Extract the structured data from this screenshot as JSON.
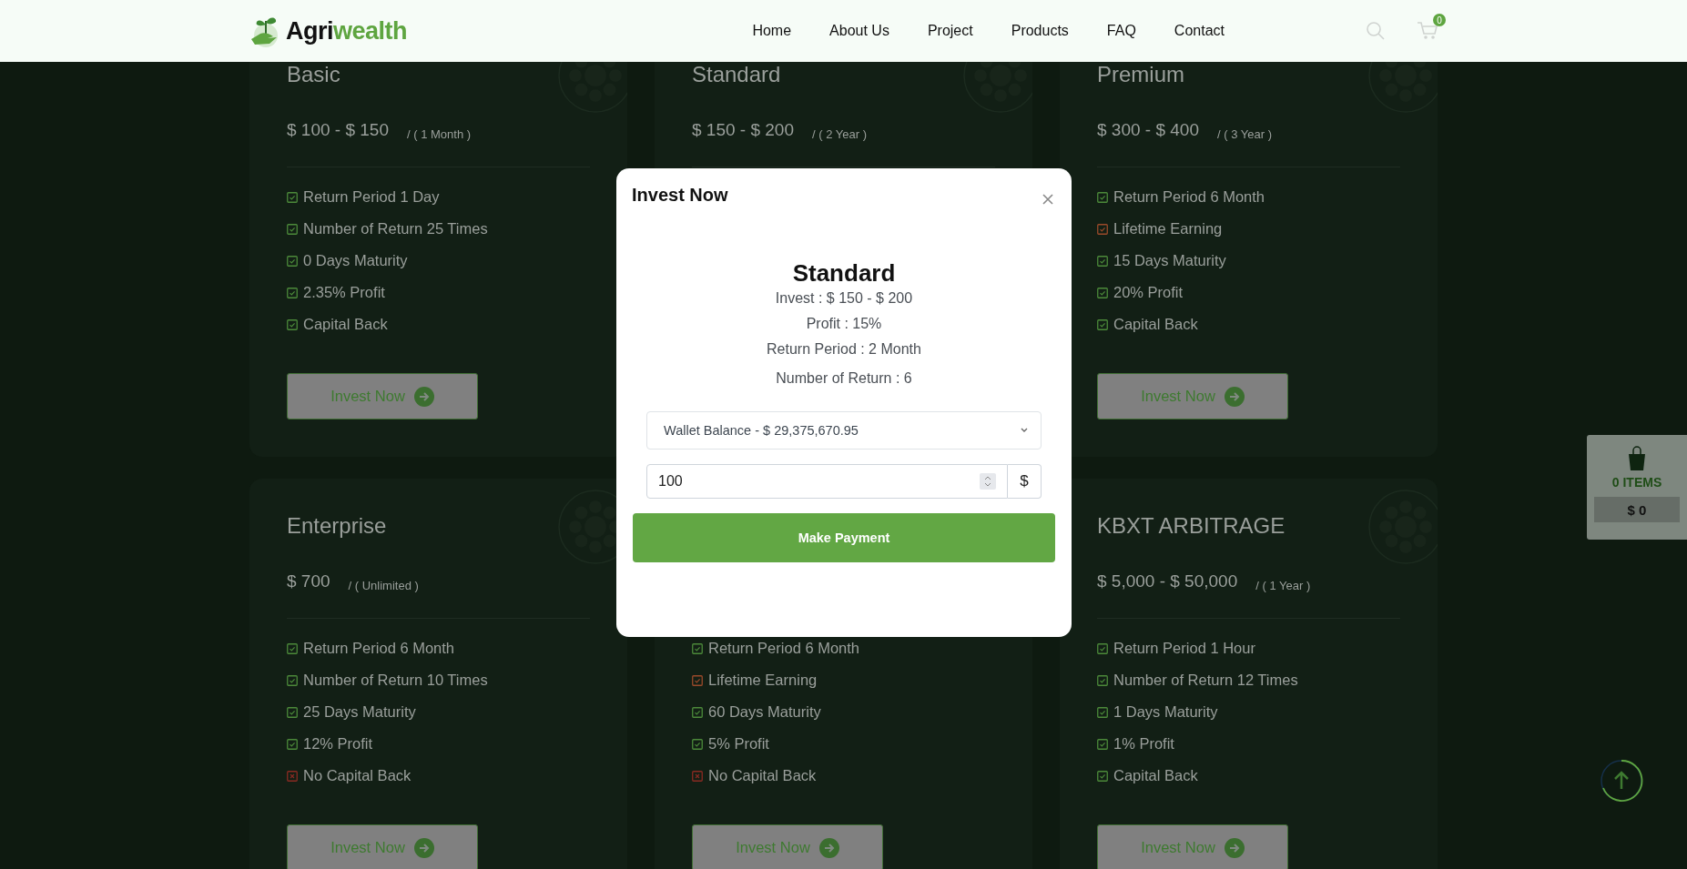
{
  "header": {
    "logo": {
      "text_1": "Agri",
      "text_2": "wealth"
    },
    "nav": [
      {
        "label": "Home"
      },
      {
        "label": "About Us"
      },
      {
        "label": "Project"
      },
      {
        "label": "Products"
      },
      {
        "label": "FAQ"
      },
      {
        "label": "Contact"
      }
    ],
    "cart_count": "0"
  },
  "plans": [
    {
      "title": "Basic",
      "price": "$ 100 - $ 150",
      "period": "/ ( 1 Month )",
      "features": [
        {
          "text": "Return Period 1 Day",
          "kind": "included"
        },
        {
          "text": "Number of Return 25 Times",
          "kind": "included"
        },
        {
          "text": "0 Days Maturity",
          "kind": "included"
        },
        {
          "text": "2.35% Profit",
          "kind": "included"
        },
        {
          "text": "Capital Back",
          "kind": "included"
        }
      ],
      "button": "Invest Now"
    },
    {
      "title": "Standard",
      "price": "$ 150 - $ 200",
      "period": "/ ( 2 Year )"
    },
    {
      "title": "Premium",
      "price": "$ 300 - $ 400",
      "period": "/ ( 3 Year )",
      "features": [
        {
          "text": "Return Period 6 Month",
          "kind": "included"
        },
        {
          "text": "Lifetime Earning",
          "kind": "bonus"
        },
        {
          "text": "15 Days Maturity",
          "kind": "included"
        },
        {
          "text": "20% Profit",
          "kind": "included"
        },
        {
          "text": "Capital Back",
          "kind": "included"
        }
      ],
      "button": "Invest Now"
    },
    {
      "title": "Enterprise",
      "price": "$ 700",
      "period": "/ ( Unlimited )",
      "features": [
        {
          "text": "Return Period 6 Month",
          "kind": "included"
        },
        {
          "text": "Number of Return 10 Times",
          "kind": "included"
        },
        {
          "text": "25 Days Maturity",
          "kind": "included"
        },
        {
          "text": "12% Profit",
          "kind": "included"
        },
        {
          "text": "No Capital Back",
          "kind": "excluded"
        }
      ],
      "button": "Invest Now"
    },
    {
      "features": [
        {
          "text": "Return Period 6 Month",
          "kind": "included"
        },
        {
          "text": "Lifetime Earning",
          "kind": "bonus"
        },
        {
          "text": "60 Days Maturity",
          "kind": "included"
        },
        {
          "text": "5% Profit",
          "kind": "included"
        },
        {
          "text": "No Capital Back",
          "kind": "excluded"
        }
      ],
      "button": "Invest Now"
    },
    {
      "title": "KBXT ARBITRAGE",
      "price": "$ 5,000 - $ 50,000",
      "period": "/ ( 1 Year )",
      "features": [
        {
          "text": "Return Period 1 Hour",
          "kind": "included"
        },
        {
          "text": "Number of Return 12 Times",
          "kind": "included"
        },
        {
          "text": "1 Days Maturity",
          "kind": "included"
        },
        {
          "text": "1% Profit",
          "kind": "included"
        },
        {
          "text": "Capital Back",
          "kind": "included"
        }
      ],
      "button": "Invest Now"
    }
  ],
  "modal": {
    "title": "Invest Now",
    "plan": "Standard",
    "details": [
      "Invest : $ 150 - $ 200",
      "Profit : 15%",
      "Return Period : 2 Month",
      "Number of Return : 6"
    ],
    "wallet_select": "Wallet Balance - $ 29,375,670.95",
    "amount": "100",
    "currency": "$",
    "submit": "Make Payment"
  },
  "cart_widget": {
    "items": "0 ITEMS",
    "total": "$ 0"
  }
}
